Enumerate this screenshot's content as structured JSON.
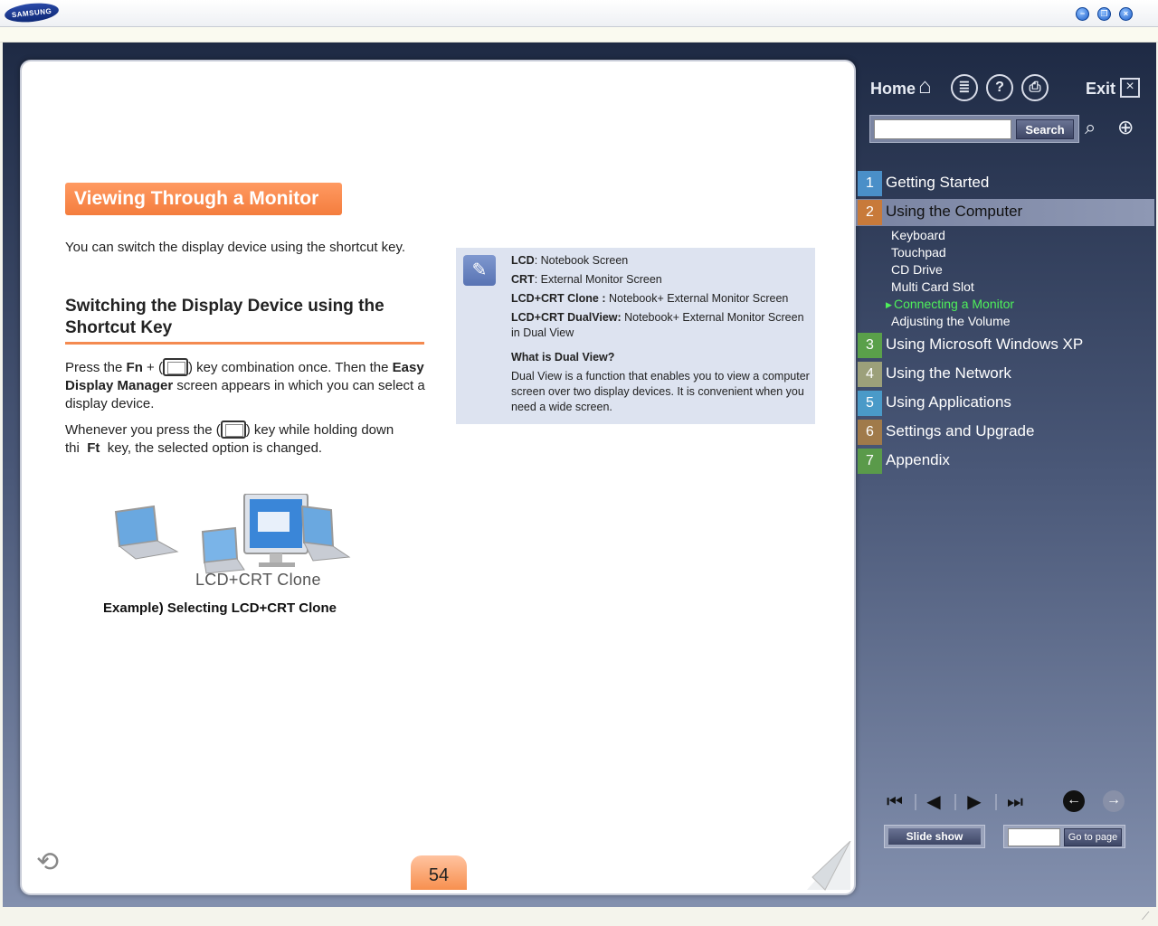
{
  "window": {
    "logo_text": "SAMSUNG",
    "buttons": {
      "minimize": "−",
      "restore": "❐",
      "close": "×"
    }
  },
  "page": {
    "title": "Viewing Through a Monitor",
    "intro": "You can switch the display device using the shortcut key.",
    "section_heading": "Switching the Display Device using the Shortcut Key",
    "para1": {
      "t1": "Press the ",
      "b1": "Fn",
      "t2": " + (",
      "t3": ") key combination once. Then the ",
      "b2": "Easy Display Manager",
      "t4": " screen appears in which you can select a display device."
    },
    "para2": {
      "t1": "Whenever you press the (",
      "t2": ") key while holding down",
      "t3": "thi",
      "b1": "Ft",
      "t4": "key, the selected option is changed."
    },
    "note": {
      "lines": [
        {
          "label": "LCD",
          "text": ": Notebook Screen"
        },
        {
          "label": "CRT",
          "text": ": External Monitor Screen"
        },
        {
          "label": "LCD+CRT Clone :",
          "text": " Notebook+ External Monitor Screen"
        },
        {
          "label": "LCD+CRT DualView:",
          "text": " Notebook+ External Monitor Screen in Dual View"
        }
      ],
      "dual_view_heading": "What is Dual View?",
      "dual_view_text": "Dual View is a function that enables you to view a computer screen over two display devices. It is convenient when you need a wide screen."
    },
    "illustration_caption": "LCD+CRT Clone",
    "example_caption": "Example) Selecting LCD+CRT Clone",
    "page_number": "54"
  },
  "nav": {
    "home_label": "Home",
    "exit_label": "Exit",
    "search_placeholder": "",
    "search_button": "Search",
    "chapters": [
      {
        "num": "1",
        "label": "Getting Started",
        "color": "#4a8fc8"
      },
      {
        "num": "2",
        "label": "Using the Computer",
        "color": "#c87a3a"
      },
      {
        "num": "3",
        "label": "Using Microsoft Windows XP",
        "color": "#5aa04a"
      },
      {
        "num": "4",
        "label": "Using the Network",
        "color": "#9ca07a"
      },
      {
        "num": "5",
        "label": "Using Applications",
        "color": "#4a9ac8"
      },
      {
        "num": "6",
        "label": "Settings and Upgrade",
        "color": "#a07a4a"
      },
      {
        "num": "7",
        "label": "Appendix",
        "color": "#5a9a4a"
      }
    ],
    "sub_items": [
      "Keyboard",
      "Touchpad",
      "CD Drive",
      "Multi Card Slot",
      "Connecting a Monitor",
      "Adjusting the Volume"
    ],
    "slide_show": "Slide show",
    "go_to_page": "Go to page",
    "page_input_value": ""
  }
}
